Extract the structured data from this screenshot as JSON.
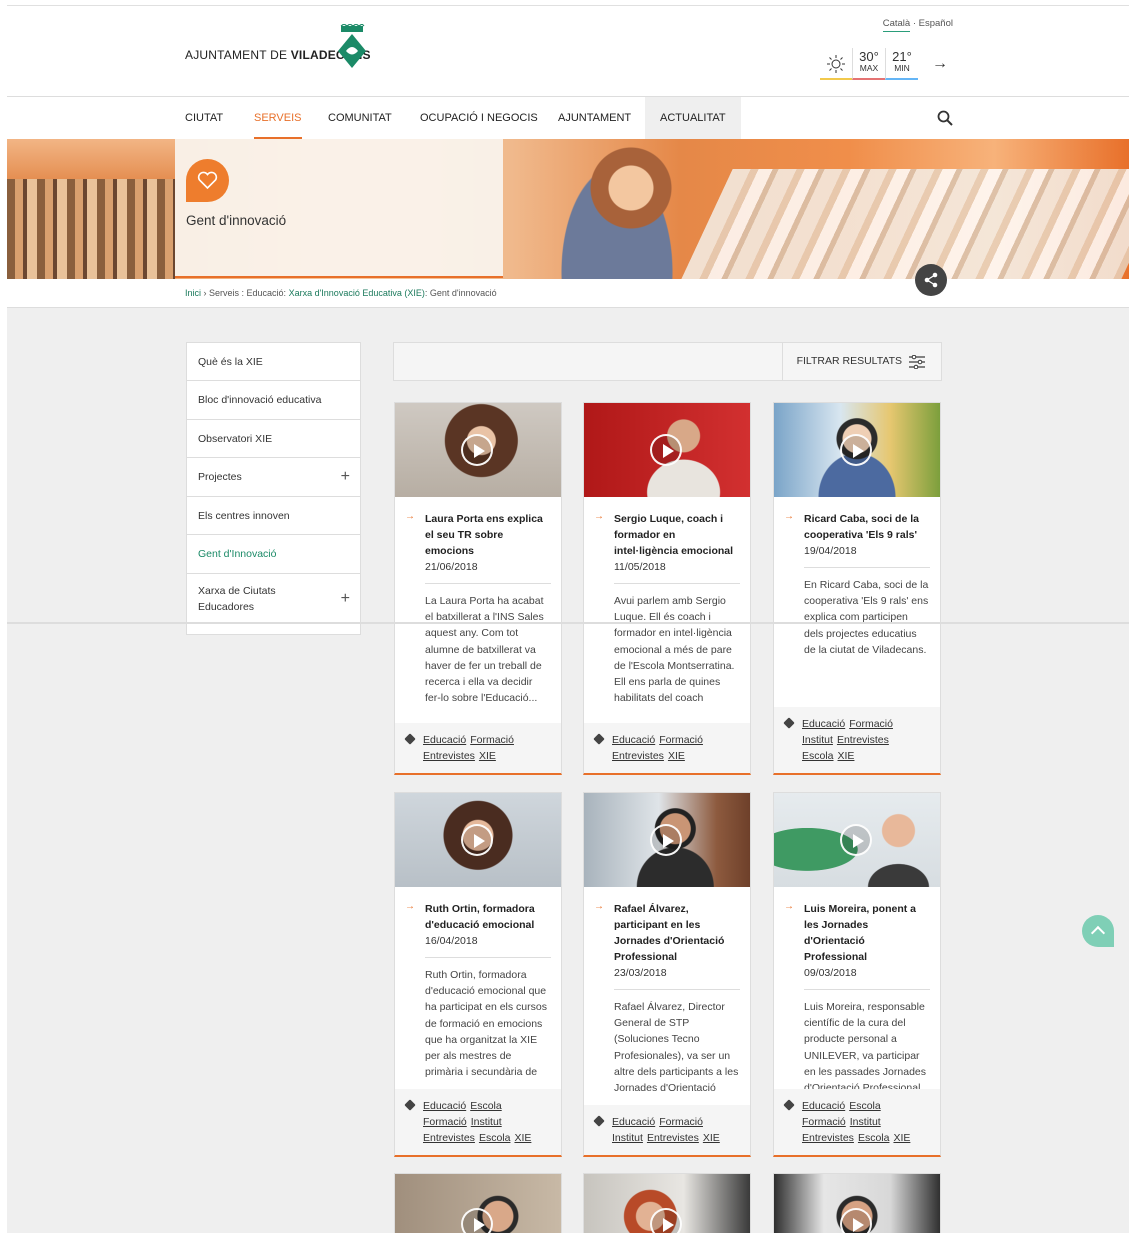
{
  "brand": {
    "prefix": "AJUNTAMENT DE ",
    "name": "VILADECANS"
  },
  "lang": {
    "ca": "Català",
    "sep": " · ",
    "es": "Español"
  },
  "weather": {
    "max": "30°",
    "max_label": "MAX",
    "min": "21°",
    "min_label": "MIN"
  },
  "nav": [
    "CIUTAT",
    "SERVEIS",
    "COMUNITAT",
    "OCUPACIÓ I NEGOCIS",
    "AJUNTAMENT",
    "ACTUALITAT"
  ],
  "hero": {
    "title": "Gent d'innovació"
  },
  "breadcrumb": {
    "home": "Inici",
    "sep1": " › Serveis : Educació: ",
    "xie": "Xarxa d'Innovació Educativa (XIE)",
    "tail": ": Gent d'innovació"
  },
  "sidebar": [
    {
      "label": "Què és la XIE"
    },
    {
      "label": "Bloc d'innovació educativa"
    },
    {
      "label": "Observatori XIE"
    },
    {
      "label": "Projectes",
      "expand": "+"
    },
    {
      "label": "Els centres innoven"
    },
    {
      "label": "Gent d'Innovació"
    },
    {
      "label": "Xarxa de Ciutats Educadores",
      "expand": "+"
    }
  ],
  "filter": {
    "label": "FILTRAR RESULTATS"
  },
  "cards": [
    {
      "title": "Laura Porta ens explica el seu TR sobre emocions",
      "date": "21/06/2018",
      "desc": "La Laura Porta ha acabat el batxillerat a l'INS Sales aquest any. Com tot alumne de batxillerat va haver de fer un treball de recerca i ella va decidir fer-lo sobre l'Educació...",
      "tags": [
        "Educació",
        "Formació",
        "Entrevistes",
        "XIE"
      ]
    },
    {
      "title": "Sergio Luque, coach i formador en intel·ligència emocional",
      "date": "11/05/2018",
      "desc": "Avui parlem amb Sergio Luque. Ell és coach i formador en intel·ligència emocional a més de pare de l'Escola Montserratina. Ell ens parla de quines habilitats del coach",
      "tags": [
        "Educació",
        "Formació",
        "Entrevistes",
        "XIE"
      ]
    },
    {
      "title": "Ricard Caba, soci de la cooperativa 'Els 9 rals'",
      "date": "19/04/2018",
      "desc": "En Ricard Caba, soci de la cooperativa 'Els 9 rals' ens explica com participen dels projectes educatius de la ciutat de Viladecans.",
      "tags": [
        "Educació",
        "Formació",
        "Institut",
        "Entrevistes",
        "Escola",
        "XIE"
      ]
    },
    {
      "title": "Ruth Ortin, formadora d'educació emocional",
      "date": "16/04/2018",
      "desc": "Ruth Ortin, formadora d'educació emocional que ha participat en els cursos de formació en emocions que ha organitzat la XIE per als mestres de primària i secundària de",
      "tags": [
        "Educació",
        "Escola",
        "Formació",
        "Institut",
        "Entrevistes",
        "Escola",
        "XIE"
      ]
    },
    {
      "title": "Rafael Álvarez, participant en les Jornades d'Orientació Professional",
      "date": "23/03/2018",
      "desc": "Rafael Álvarez, Director General de STP (Soluciones Tecno Profesionales), va ser un altre dels participants a les Jornades d'Orientació",
      "tags": [
        "Educació",
        "Formació",
        "Institut",
        "Entrevistes",
        "XIE"
      ]
    },
    {
      "title": "Luis Moreira, ponent a les Jornades d'Orientació Professional",
      "date": "09/03/2018",
      "desc": "Luis Moreira, responsable científic de la cura del producte personal a UNILEVER, va participar en les passades Jornades d'Orientació Professional",
      "tags": [
        "Educació",
        "Escola",
        "Formació",
        "Institut",
        "Entrevistes",
        "Escola",
        "XIE"
      ]
    }
  ],
  "colors": {
    "accent": "#e8702a",
    "green": "#1b8a67",
    "totop": "#7fcfb6"
  }
}
